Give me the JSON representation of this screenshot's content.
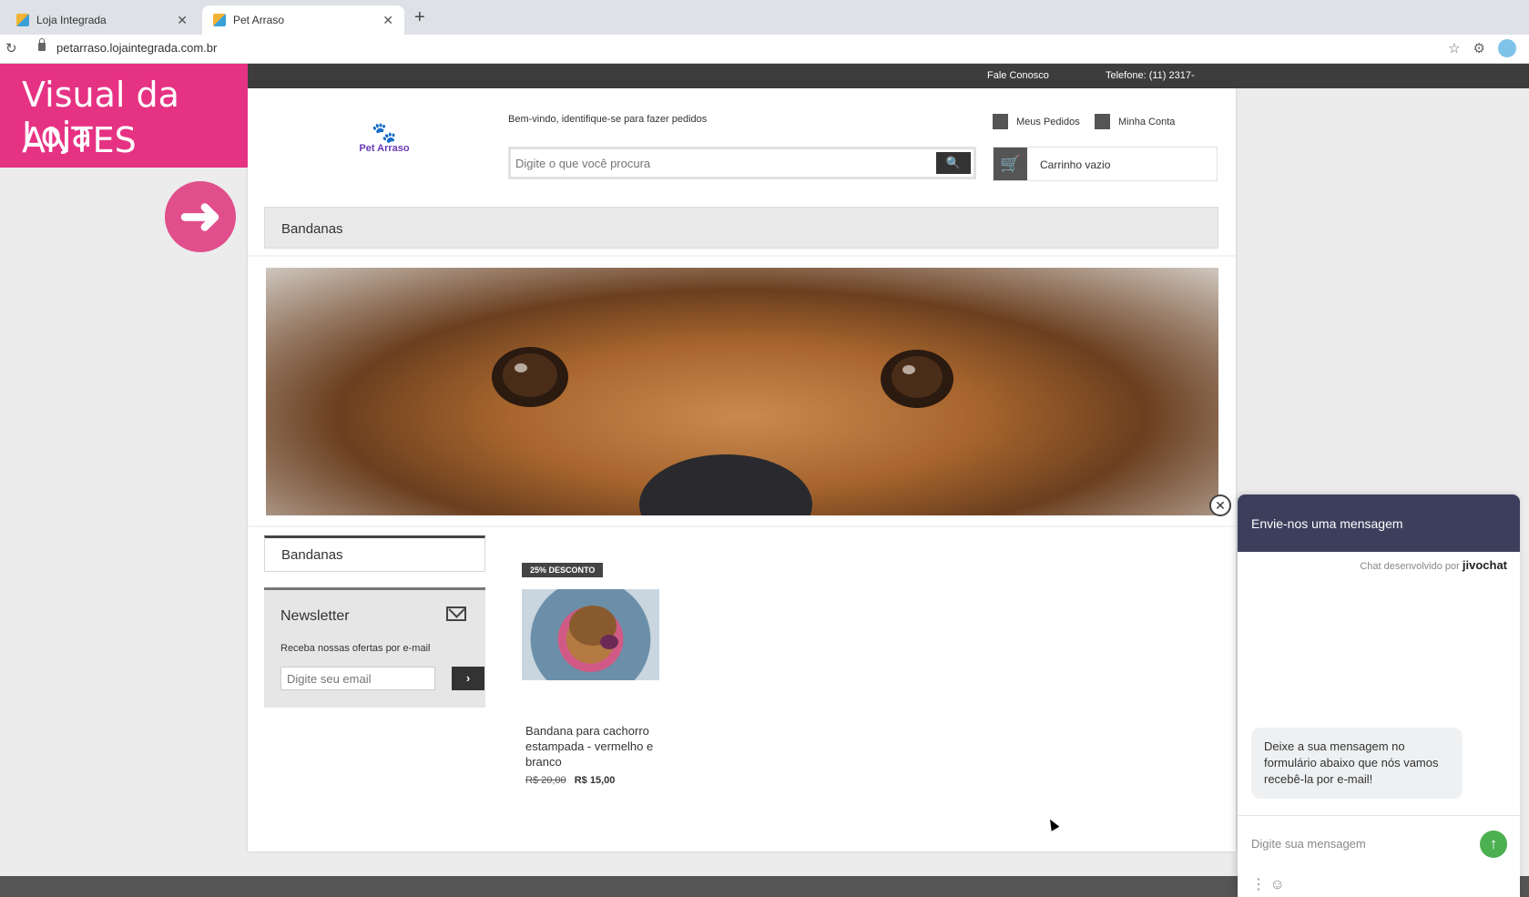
{
  "browser": {
    "tabs": [
      {
        "label": "Loja Integrada"
      },
      {
        "label": "Pet Arraso"
      }
    ],
    "close_glyph": "✕",
    "new_tab_glyph": "+",
    "reload_glyph": "↻",
    "url": "petarraso.lojaintegrada.com.br",
    "star_glyph": "☆",
    "ext_glyph": "⚙"
  },
  "overlay": {
    "line1": "Visual da Loja",
    "line2": "ANTES",
    "arrow_glyph": "➜",
    "accent": "#e63283"
  },
  "topstrip": {
    "contact": "Fale Conosco",
    "phone": "Telefone: (11) 2317-"
  },
  "header": {
    "logo_text": "Pet Arraso",
    "paw_glyph": "🐾",
    "welcome": "Bem-vindo, identifique-se para fazer pedidos",
    "search_placeholder": "Digite o que você procura",
    "search_glyph": "🔍",
    "orders": "Meus Pedidos",
    "account": "Minha Conta",
    "cart_glyph": "🛒",
    "cart": "Carrinho vazio"
  },
  "category_bar": "Bandanas",
  "sidebar": {
    "category": "Bandanas",
    "newsletter_title": "Newsletter",
    "newsletter_sub": "Receba nossas ofertas por e-mail",
    "email_placeholder": "Digite seu email",
    "go_glyph": "›"
  },
  "product": {
    "badge": "25% DESCONTO",
    "name": "Bandana para cachorro estampada - vermelho e branco",
    "old_price": "R$ 20,00",
    "new_price": "R$ 15,00"
  },
  "chat": {
    "close_glyph": "✕",
    "title": "Envie-nos uma mensagem",
    "powered_by": "Chat desenvolvido por",
    "brand": "jivochat",
    "bubble": "Deixe a sua mensagem no formulário abaixo que nós vamos recebê-la por e-mail!",
    "input_placeholder": "Digite sua mensagem",
    "send_glyph": "↑",
    "tools_glyph": "⋮ ☺"
  }
}
